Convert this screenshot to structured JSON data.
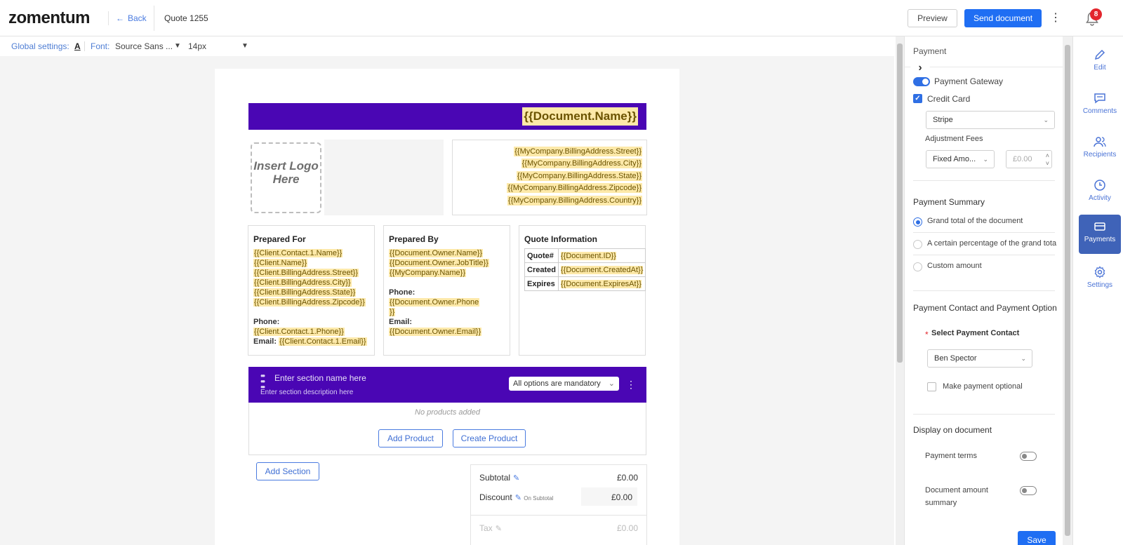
{
  "header": {
    "logo": "zomentum",
    "back_label": "Back",
    "quote_title": "Quote 1255",
    "preview_label": "Preview",
    "send_label": "Send document",
    "notification_count": "8"
  },
  "global_settings": {
    "label": "Global settings:",
    "font_color_glyph": "A",
    "font_label": "Font:",
    "font_value": "Source Sans ...",
    "size_value": "14px"
  },
  "document": {
    "name_placeholder": "{{Document.Name}}",
    "logo_placeholder": "Insert Logo Here",
    "company_address": [
      "{{MyCompany.BillingAddress.Street}}",
      "{{MyCompany.BillingAddress.City}}",
      "{{MyCompany.BillingAddress.State}}",
      "{{MyCompany.BillingAddress.Zipcode}}",
      "{{MyCompany.BillingAddress.Country}}"
    ],
    "prepared_for": {
      "title": "Prepared For",
      "lines": [
        "{{Client.Contact.1.Name}}",
        "{{Client.Name}}",
        "{{Client.BillingAddress.Street}}",
        "{{Client.BillingAddress.City}}",
        "{{Client.BillingAddress.State}}",
        "{{Client.BillingAddress.Zipcode}}"
      ],
      "phone_label": "Phone:",
      "phone_value": "{{Client.Contact.1.Phone}}",
      "email_label": "Email:",
      "email_value": "{{Client.Contact.1.Email}}"
    },
    "prepared_by": {
      "title": "Prepared By",
      "lines": [
        "{{Document.Owner.Name}}",
        "{{Document.Owner.JobTitle}}",
        "{{MyCompany.Name}}"
      ],
      "phone_label": "Phone:",
      "phone_value_1": "{{Document.Owner.Phone",
      "phone_value_2": "}}",
      "email_label": "Email:",
      "email_value": "{{Document.Owner.Email}}"
    },
    "quote_info": {
      "title": "Quote Information",
      "rows": [
        {
          "key": "Quote#",
          "value": "{{Document.ID}}"
        },
        {
          "key": "Created",
          "value": "{{Document.CreatedAt}}"
        },
        {
          "key": "Expires",
          "value": "{{Document.ExpiresAt}}"
        }
      ]
    },
    "section": {
      "name_placeholder": "Enter section name here",
      "description_placeholder": "Enter section description here",
      "mandatory_option": "All options are mandatory",
      "no_products": "No products added",
      "add_product": "Add Product",
      "create_product": "Create Product"
    },
    "add_section": "Add Section",
    "totals": {
      "subtotal_label": "Subtotal",
      "subtotal_value": "£0.00",
      "discount_label": "Discount",
      "discount_note": "On Subtotal",
      "discount_value": "£0.00",
      "tax_label": "Tax",
      "tax_value": "£0.00"
    }
  },
  "payment_panel": {
    "title": "Payment",
    "gateway_label": "Payment Gateway",
    "gateway_enabled": true,
    "credit_card_label": "Credit Card",
    "credit_card_checked": true,
    "processor_value": "Stripe",
    "adjustment_label": "Adjustment Fees",
    "adjustment_type": "Fixed Amo...",
    "adjustment_placeholder": "£0.00",
    "summary_title": "Payment Summary",
    "summary_options": [
      "Grand total of the document",
      "A certain percentage of the grand tota",
      "Custom amount"
    ],
    "summary_selected_index": 0,
    "contact_title": "Payment Contact and Payment Option",
    "select_contact_label": "Select Payment Contact",
    "required_mark": "*",
    "contact_value": "Ben Spector",
    "optional_label": "Make payment optional",
    "display_title": "Display on document",
    "terms_label": "Payment terms",
    "amount_summary_label_1": "Document amount",
    "amount_summary_label_2": "summary",
    "save_label": "Save"
  },
  "rail": {
    "items": [
      "Edit",
      "Comments",
      "Recipients",
      "Activity",
      "Payments",
      "Settings"
    ],
    "active": "Payments"
  },
  "colors": {
    "accent": "#1f6ef3",
    "banner": "#4a06b4",
    "placeholder_bg": "#fde9a9",
    "rail_active": "#3f63b8"
  }
}
